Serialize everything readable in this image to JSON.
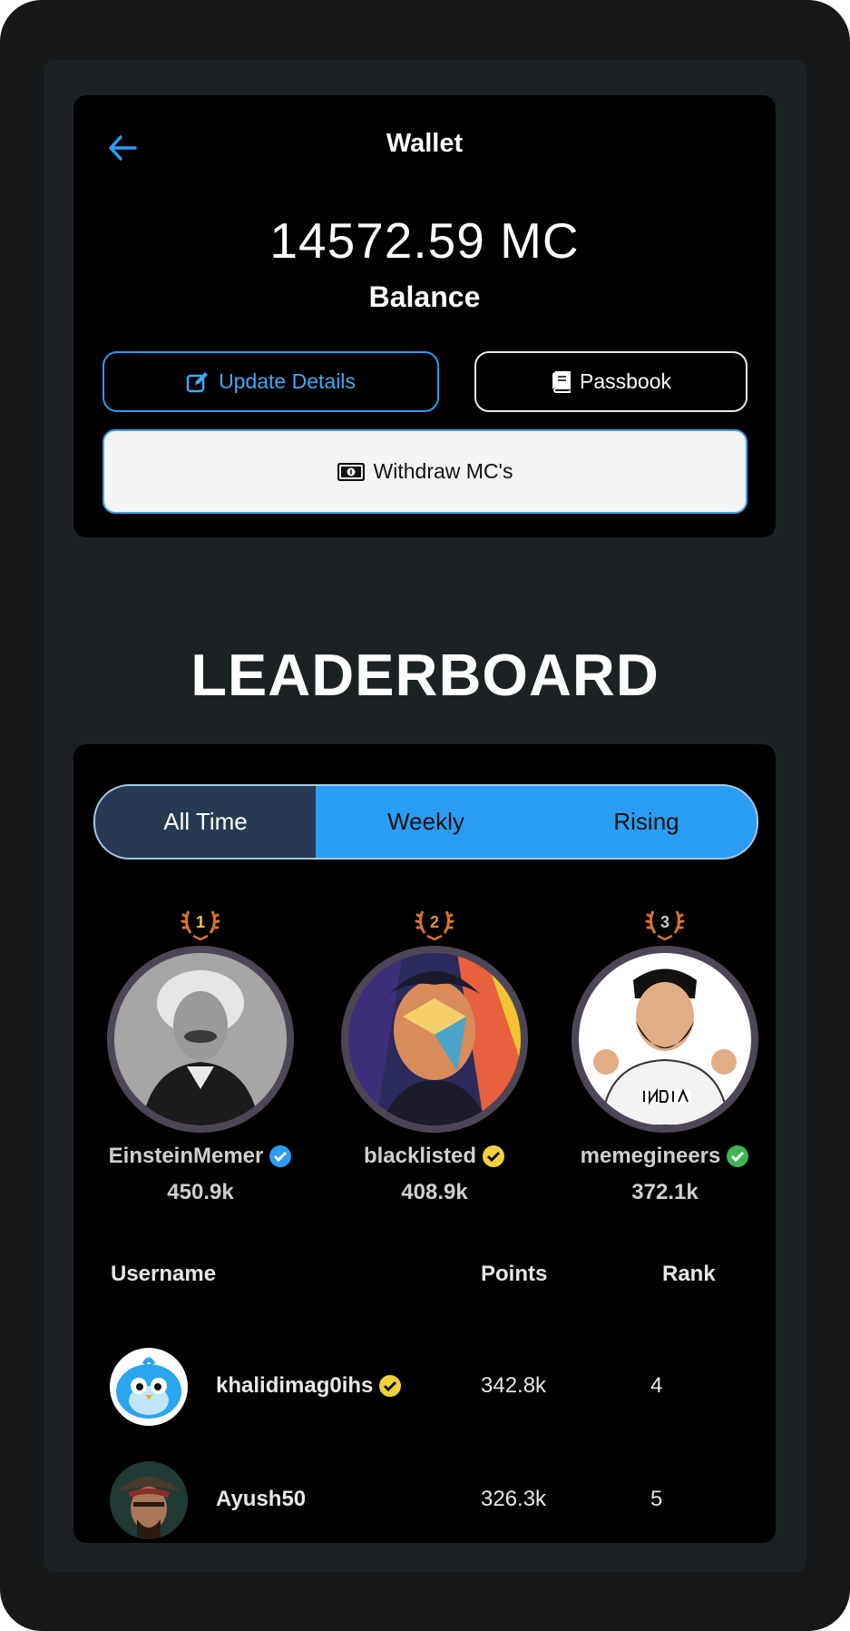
{
  "wallet": {
    "title": "Wallet",
    "balance": "14572.59 MC",
    "balance_label": "Balance",
    "update_label": "Update Details",
    "passbook_label": "Passbook",
    "withdraw_label": "Withdraw MC's"
  },
  "leaderboard": {
    "title": "LEADERBOARD",
    "tabs": [
      {
        "label": "All Time",
        "active": true
      },
      {
        "label": "Weekly",
        "active": false
      },
      {
        "label": "Rising",
        "active": false
      }
    ],
    "podium": [
      {
        "rank": "1",
        "name": "EinsteinMemer",
        "points": "450.9k",
        "badge_color": "#2a9df4"
      },
      {
        "rank": "2",
        "name": "blacklisted",
        "points": "408.9k",
        "badge_color": "#f2d13a"
      },
      {
        "rank": "3",
        "name": "memegineers",
        "points": "372.1k",
        "badge_color": "#3fb553"
      }
    ],
    "columns": {
      "username": "Username",
      "points": "Points",
      "rank": "Rank"
    },
    "rows": [
      {
        "username": "khalidimag0ihs",
        "points": "342.8k",
        "rank": "4",
        "verified": true,
        "badge_color": "#f2d13a"
      },
      {
        "username": "Ayush50",
        "points": "326.3k",
        "rank": "5",
        "verified": false
      }
    ]
  },
  "colors": {
    "accent": "#2a9df4",
    "active_tab": "#283a52",
    "background": "#1c2124"
  }
}
